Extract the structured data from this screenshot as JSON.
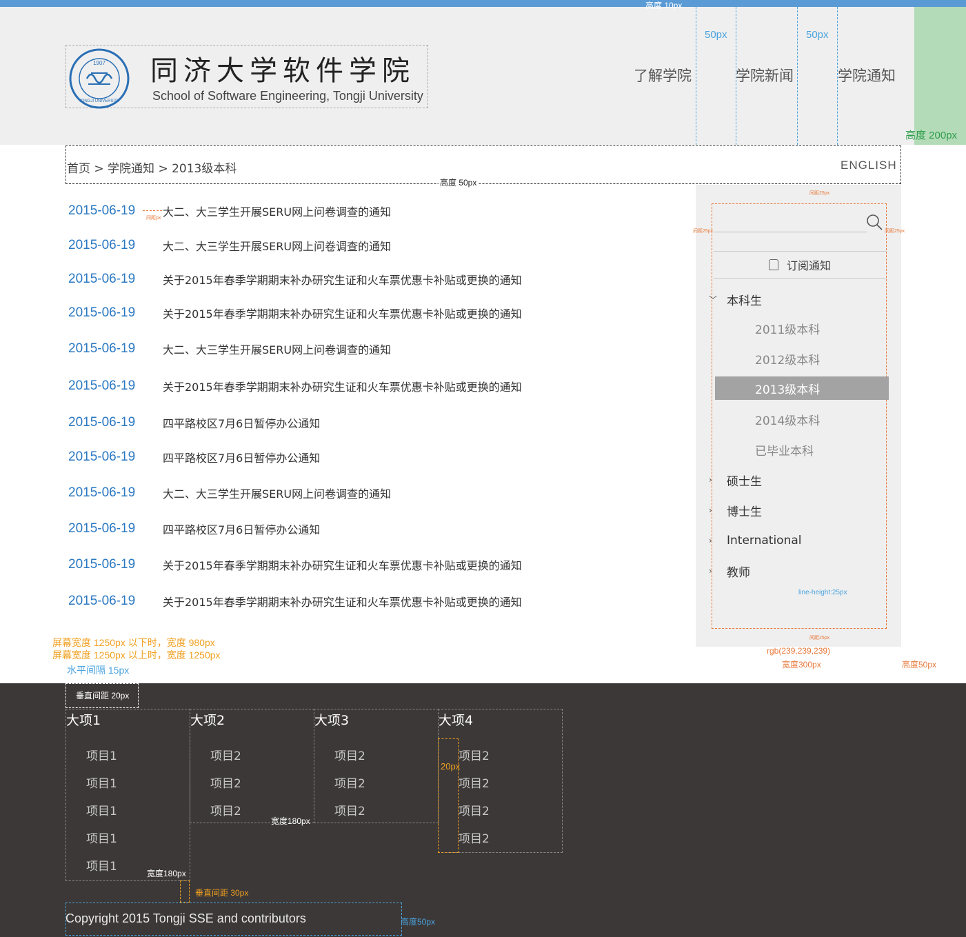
{
  "colors": {
    "accent": "#5b9bd5",
    "date": "#2a78c2",
    "header_bg": "#efefef",
    "footer_bg": "#3c3837",
    "annotation_blue": "#4aa3df",
    "annotation_orange": "#e8793a",
    "annotation_green": "#2e9e4a",
    "annotation_gold": "#f0a020"
  },
  "header": {
    "logo_cn": "同济大学软件学院",
    "logo_en": "School of Software Engineering, Tongji University",
    "seal_year": "1907",
    "seal_text": "TONGJI UNIVERSITY",
    "nav": [
      "了解学院",
      "学院新闻",
      "学院通知"
    ]
  },
  "breadcrumb": {
    "text": "首页 > 学院通知 > 2013级本科",
    "lang": "ENGLISH"
  },
  "notices": [
    {
      "date": "2015-06-19",
      "title": "大二、大三学生开展SERU网上问卷调查的通知"
    },
    {
      "date": "2015-06-19",
      "title": "大二、大三学生开展SERU网上问卷调查的通知"
    },
    {
      "date": "2015-06-19",
      "title": "关于2015年春季学期期末补办研究生证和火车票优惠卡补贴或更换的通知"
    },
    {
      "date": "2015-06-19",
      "title": "关于2015年春季学期期末补办研究生证和火车票优惠卡补贴或更换的通知"
    },
    {
      "date": "2015-06-19",
      "title": "大二、大三学生开展SERU网上问卷调查的通知"
    },
    {
      "date": "2015-06-19",
      "title": "关于2015年春季学期期末补办研究生证和火车票优惠卡补贴或更换的通知"
    },
    {
      "date": "2015-06-19",
      "title": "四平路校区7月6日暂停办公通知"
    },
    {
      "date": "2015-06-19",
      "title": "四平路校区7月6日暂停办公通知"
    },
    {
      "date": "2015-06-19",
      "title": "大二、大三学生开展SERU网上问卷调查的通知"
    },
    {
      "date": "2015-06-19",
      "title": "四平路校区7月6日暂停办公通知"
    },
    {
      "date": "2015-06-19",
      "title": "关于2015年春季学期期末补办研究生证和火车票优惠卡补贴或更换的通知"
    },
    {
      "date": "2015-06-19",
      "title": "关于2015年春季学期期末补办研究生证和火车票优惠卡补贴或更换的通知"
    }
  ],
  "sidebar": {
    "subscribe_label": "订阅通知",
    "categories": [
      {
        "label": "本科生",
        "expanded": true
      },
      {
        "label": "硕士生",
        "expanded": false
      },
      {
        "label": "博士生",
        "expanded": false
      },
      {
        "label": "International",
        "expanded": false
      },
      {
        "label": "教师",
        "expanded": false
      }
    ],
    "undergrad_items": [
      "2011级本科",
      "2012级本科",
      "2013级本科",
      "2014级本科",
      "已毕业本科"
    ],
    "active_item": "2013级本科"
  },
  "footer": {
    "columns": [
      {
        "title": "大项1",
        "items": [
          "项目1",
          "项目1",
          "项目1",
          "项目1",
          "项目1"
        ]
      },
      {
        "title": "大项2",
        "items": [
          "项目2",
          "项目2",
          "项目2"
        ]
      },
      {
        "title": "大项3",
        "items": [
          "项目2",
          "项目2",
          "项目2"
        ]
      },
      {
        "title": "大项4",
        "items": [
          "项目2",
          "项目2",
          "项目2",
          "项目2"
        ]
      }
    ],
    "copyright": "Copyright 2015 Tongji SSE and contributors"
  },
  "annotations": {
    "top_height": "高度 10px",
    "nav_gap_1": "50px",
    "nav_gap_2": "50px",
    "header_height": "高度 200px",
    "crumb_height": "高度 50px",
    "date_gap": "间距px",
    "sidebar_top_gap": "间距25px",
    "sidebar_left_gap": "间距25px",
    "sidebar_right_gap": "间距25px",
    "line_height": "line-height:25px",
    "sidebar_bottom_gap": "间距25px",
    "sidebar_color": "rgb(239,239,239)",
    "sidebar_width": "宽度300px",
    "sidebar_bottom_height": "高度50px",
    "screen_small": "屏幕宽度 1250px 以下时，宽度 980px",
    "screen_large": "屏幕宽度 1250px 以上时，宽度 1250px",
    "h_gap": "水平间隔 15px",
    "v_gap_20": "垂直间距 20px",
    "col_width_1": "宽度180px",
    "col_width_2": "宽度180px",
    "item_gap": "20px",
    "v_gap_30": "垂直间距 30px",
    "copy_height": "高度50px"
  }
}
